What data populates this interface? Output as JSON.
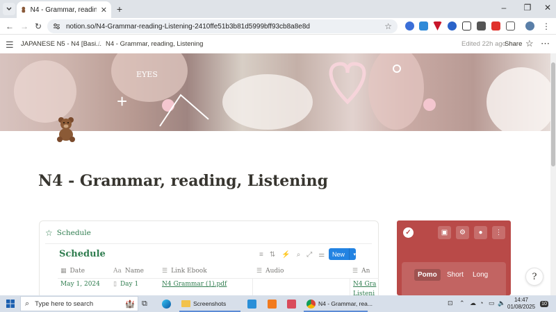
{
  "browser": {
    "tab_title": "N4 - Grammar, reading, Listening",
    "url": "notion.so/N4-Grammar-reading-Listening-2410ffe51b3b81d5999bff93cb8a8e8d"
  },
  "notion_topbar": {
    "breadcrumb_parent": "JAPANESE N5 - N4 [Basi...",
    "breadcrumb_separator": "/",
    "breadcrumb_current": "N4 - Grammar, reading, Listening",
    "edited": "Edited 22h ago",
    "share_label": "Share"
  },
  "page": {
    "title": "N4 - Grammar, reading, Listening"
  },
  "schedule_block": {
    "header_label": "Schedule",
    "database_title": "Schedule",
    "new_button": "New",
    "columns": [
      "Date",
      "Name",
      "Link Ebook",
      "Audio",
      "An"
    ],
    "rows": [
      {
        "date": "May 1, 2024",
        "name": "Day 1",
        "link_ebook": "N4 Grammar (1).pdf",
        "audio": "",
        "an": "N4 Gra",
        "an_line2": "Listeni"
      }
    ]
  },
  "pomodoro": {
    "tabs": [
      "Pomo",
      "Short",
      "Long"
    ],
    "active_tab": "Pomo"
  },
  "taskbar": {
    "search_placeholder": "Type here to search",
    "apps": [
      {
        "label": "Screenshots"
      },
      {
        "label": "N4 - Grammar, rea..."
      }
    ],
    "time": "14:47",
    "date": "01/08/2025",
    "notification_count": "10"
  },
  "colors": {
    "notion_green": "#2f7d4f",
    "pomodoro_red": "#b94a48",
    "new_button_blue": "#2383e2"
  }
}
